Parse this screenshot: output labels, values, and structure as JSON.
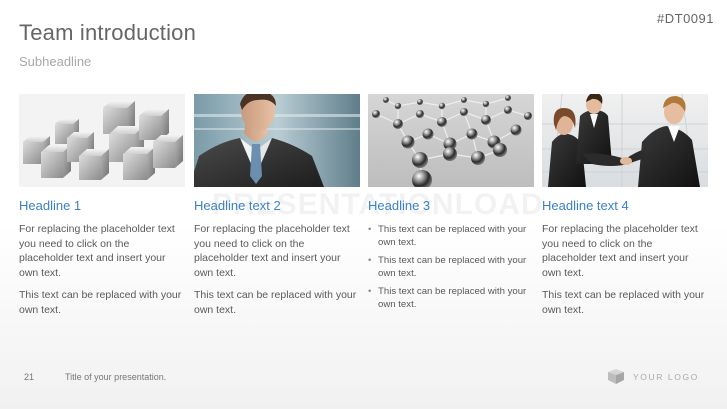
{
  "slide": {
    "title": "Team introduction",
    "subtitle": "Subheadline",
    "code": "#DT0091",
    "watermark": "PRESENTATIONLOAD"
  },
  "columns": [
    {
      "image_icon": "silver-cubes-image",
      "headline": "Headline 1",
      "paragraphs": [
        "For replacing the placeholder text you need to click on the placeholder text and insert your own text.",
        "This text can be replaced with your own text."
      ]
    },
    {
      "image_icon": "businessman-portrait-image",
      "headline": "Headline text 2",
      "paragraphs": [
        "For replacing the placeholder text you need to click on the placeholder text and insert your own text.",
        "This text can be replaced with your own text."
      ]
    },
    {
      "image_icon": "network-spheres-image",
      "headline": "Headline 3",
      "bullets": [
        "This text can be replaced with your own text.",
        "This text can be replaced with your own text.",
        "This text can be replaced with your own text."
      ]
    },
    {
      "image_icon": "business-handshake-image",
      "headline": "Headline text 4",
      "paragraphs": [
        "For replacing the placeholder text you need to click on the placeholder text and insert your own text.",
        "This text can be replaced with your own text."
      ]
    }
  ],
  "footer": {
    "page_number": "21",
    "presentation_title": "Title of your presentation.",
    "logo_text": "YOUR LOGO"
  }
}
